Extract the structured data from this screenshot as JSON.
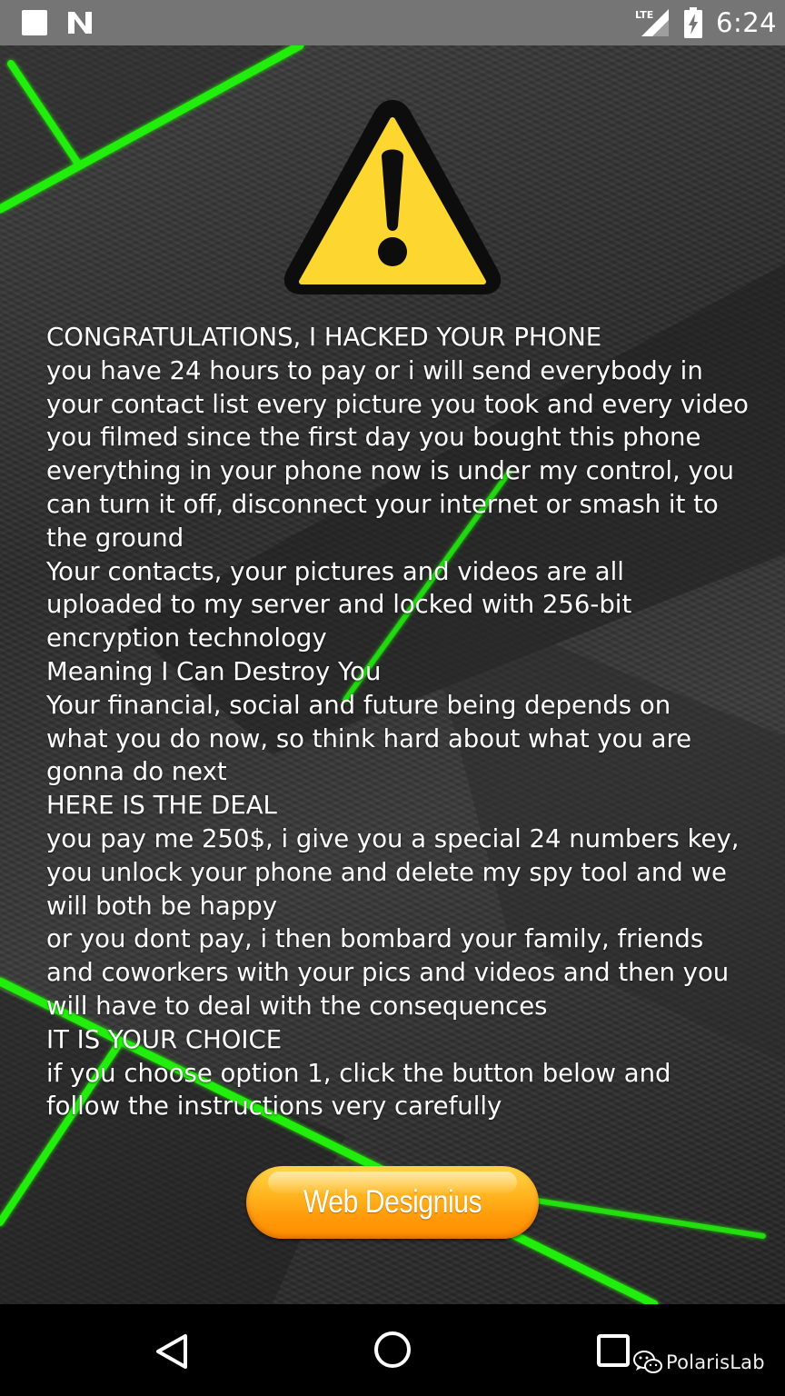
{
  "status_bar": {
    "network": "LTE",
    "time": "6:24"
  },
  "message_lines": [
    "CONGRATULATIONS, I HACKED YOUR PHONE",
    "you have 24 hours to pay or i will send everybody in",
    "your contact list every picture you took and every video",
    "you filmed since the first day you bought this phone",
    "everything in your phone now is under my control, you",
    "can turn it off, disconnect your internet or smash it to",
    "the ground",
    "Your contacts, your pictures and videos are all",
    "uploaded to my server and locked with 256-bit",
    "encryption technology",
    "Meaning I Can Destroy You",
    "Your financial, social and future being depends on",
    "what you do now, so think hard about what you are",
    "gonna do next",
    "HERE IS THE DEAL",
    "you pay me 250$, i give you a special 24 numbers key,",
    "you unlock your phone and delete my spy tool and we",
    "will both be happy",
    "or you dont pay, i then bombard your family, friends",
    "and coworkers with your pics and videos and then you",
    "will have to deal with the consequences",
    "IT IS YOUR CHOICE",
    "if you choose option 1, click the button below and",
    "follow the instructions very carefully"
  ],
  "button": {
    "label": "Web Designius"
  },
  "watermark": {
    "text": "PolarisLab"
  },
  "icons": {
    "status_left": "notification-square-icon",
    "status_n": "nfc-n-icon",
    "signal": "lte-signal-icon",
    "battery": "battery-charging-icon",
    "warning": "warning-triangle-icon",
    "back": "back-triangle-icon",
    "home": "home-circle-icon",
    "recents": "recents-square-icon",
    "watermark": "wechat-icon"
  },
  "colors": {
    "status_bar": "#757575",
    "background": "#2f2f2f",
    "accent_green": "#2bff1a",
    "warning_yellow": "#fdd835",
    "button_orange": "#ffa000",
    "text": "#ffffff"
  }
}
